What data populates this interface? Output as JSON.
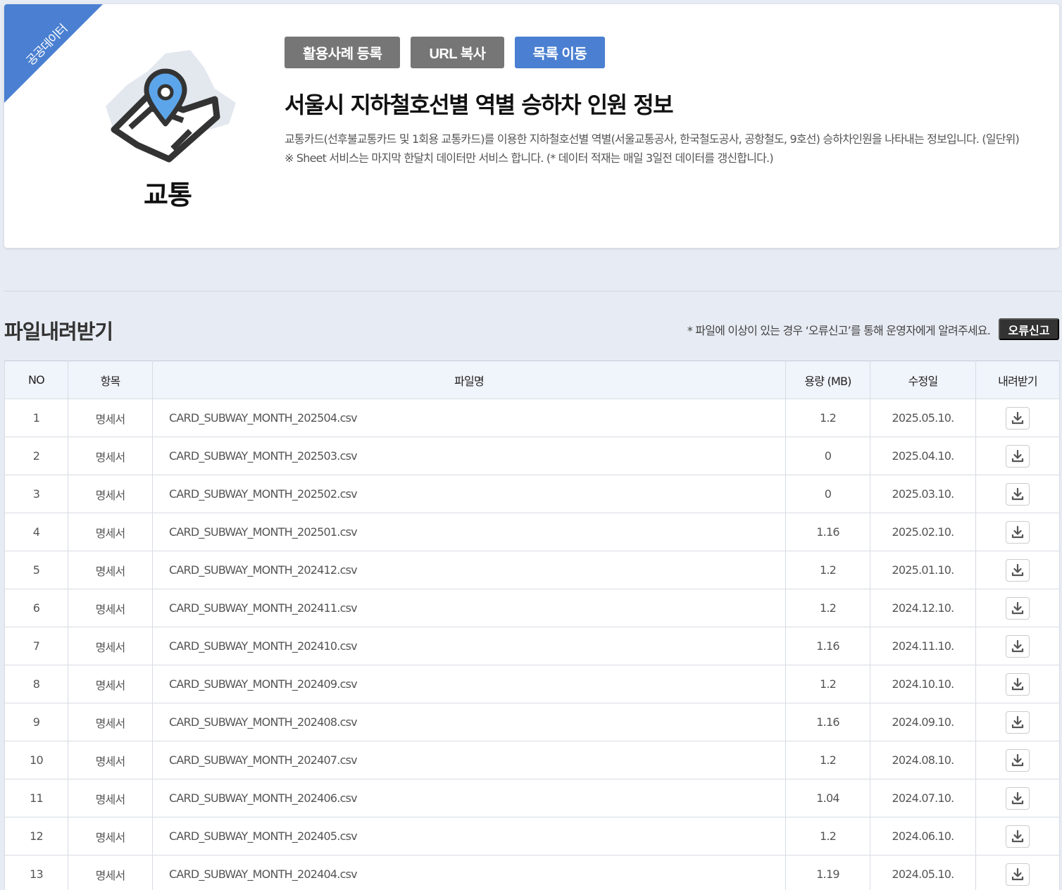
{
  "ribbon": "공공데이터",
  "category": {
    "label": "교통",
    "icon": "map-pin-icon"
  },
  "buttons": {
    "register": "활용사례 등록",
    "copy_url": "URL 복사",
    "list": "목록 이동"
  },
  "title": "서울시 지하철호선별 역별 승하차 인원 정보",
  "description": {
    "line1": "교통카드(선후불교통카드 및 1회용 교통카드)를 이용한 지하철호선별 역별(서울교통공사, 한국철도공사, 공항철도, 9호선) 승하차인원을 나타내는 정보입니다. (일단위)",
    "line2": "※ Sheet 서비스는 마지막 한달치 데이터만 서비스 합니다. (* 데이터 적재는 매일 3일전 데이터를 갱신합니다.)"
  },
  "download_section": {
    "title": "파일내려받기",
    "notice": "* 파일에 이상이 있는 경우 ‘오류신고’를 통해 운영자에게 알려주세요.",
    "report_button": "오류신고",
    "headers": {
      "no": "NO",
      "item": "항목",
      "filename": "파일명",
      "size": "용량 (MB)",
      "modified": "수정일",
      "download": "내려받기"
    },
    "rows": [
      {
        "no": "1",
        "item": "명세서",
        "filename": "CARD_SUBWAY_MONTH_202504.csv",
        "size": "1.2",
        "modified": "2025.05.10."
      },
      {
        "no": "2",
        "item": "명세서",
        "filename": "CARD_SUBWAY_MONTH_202503.csv",
        "size": "0",
        "modified": "2025.04.10."
      },
      {
        "no": "3",
        "item": "명세서",
        "filename": "CARD_SUBWAY_MONTH_202502.csv",
        "size": "0",
        "modified": "2025.03.10."
      },
      {
        "no": "4",
        "item": "명세서",
        "filename": "CARD_SUBWAY_MONTH_202501.csv",
        "size": "1.16",
        "modified": "2025.02.10."
      },
      {
        "no": "5",
        "item": "명세서",
        "filename": "CARD_SUBWAY_MONTH_202412.csv",
        "size": "1.2",
        "modified": "2025.01.10."
      },
      {
        "no": "6",
        "item": "명세서",
        "filename": "CARD_SUBWAY_MONTH_202411.csv",
        "size": "1.2",
        "modified": "2024.12.10."
      },
      {
        "no": "7",
        "item": "명세서",
        "filename": "CARD_SUBWAY_MONTH_202410.csv",
        "size": "1.16",
        "modified": "2024.11.10."
      },
      {
        "no": "8",
        "item": "명세서",
        "filename": "CARD_SUBWAY_MONTH_202409.csv",
        "size": "1.2",
        "modified": "2024.10.10."
      },
      {
        "no": "9",
        "item": "명세서",
        "filename": "CARD_SUBWAY_MONTH_202408.csv",
        "size": "1.16",
        "modified": "2024.09.10."
      },
      {
        "no": "10",
        "item": "명세서",
        "filename": "CARD_SUBWAY_MONTH_202407.csv",
        "size": "1.2",
        "modified": "2024.08.10."
      },
      {
        "no": "11",
        "item": "명세서",
        "filename": "CARD_SUBWAY_MONTH_202406.csv",
        "size": "1.04",
        "modified": "2024.07.10."
      },
      {
        "no": "12",
        "item": "명세서",
        "filename": "CARD_SUBWAY_MONTH_202405.csv",
        "size": "1.2",
        "modified": "2024.06.10."
      },
      {
        "no": "13",
        "item": "명세서",
        "filename": "CARD_SUBWAY_MONTH_202404.csv",
        "size": "1.19",
        "modified": "2024.05.10."
      }
    ]
  },
  "colors": {
    "accent": "#4a7fd1",
    "button_gray": "#767676",
    "page_bg": "#e7ebf3",
    "header_bg": "#f0f4fb"
  }
}
